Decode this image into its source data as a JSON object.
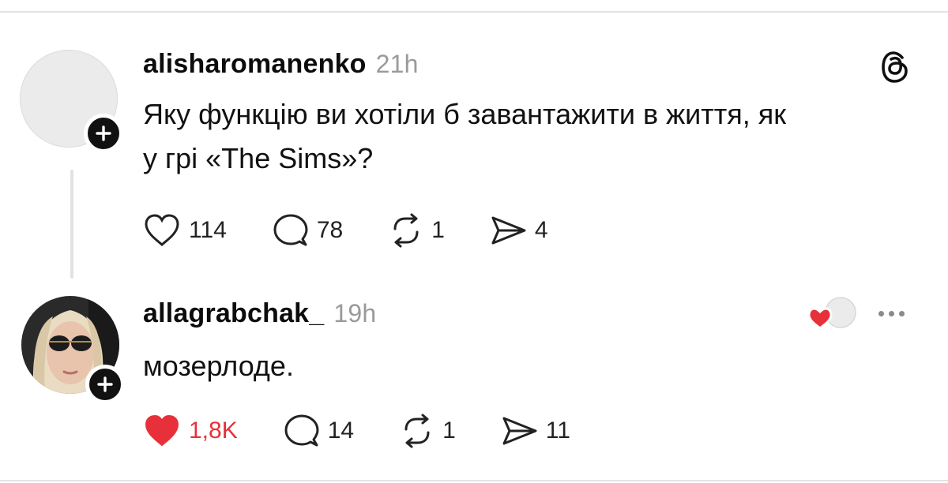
{
  "colors": {
    "like_red": "#e8303a",
    "muted": "#9a9a9a",
    "text": "#111111"
  },
  "post": {
    "username": "alisharomanenko",
    "time": "21h",
    "text_line1": "Яку функцію ви хотіли б завантажити в життя, як",
    "text_line2": "у грі «The Sims»?",
    "likes": "114",
    "replies": "78",
    "reposts": "1",
    "shares": "4",
    "icons": {
      "logo": "threads-logo-icon",
      "like": "heart-outline-icon",
      "reply": "comment-bubble-icon",
      "repost": "repost-icon",
      "share": "send-icon",
      "follow": "plus-icon"
    }
  },
  "reply": {
    "username": "allagrabchak_",
    "time": "19h",
    "text": "мозерлоде.",
    "likes": "1,8K",
    "replies": "14",
    "reposts": "1",
    "shares": "11",
    "icons": {
      "like": "heart-filled-icon",
      "reply": "comment-bubble-icon",
      "repost": "repost-icon",
      "share": "send-icon",
      "more": "more-options-icon",
      "liked_by_author": "author-liked-heart-icon",
      "follow": "plus-icon"
    }
  }
}
